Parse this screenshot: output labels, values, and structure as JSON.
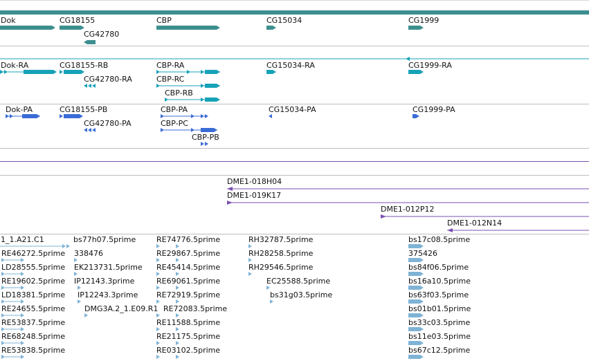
{
  "colors": {
    "gene": "#3d8f8f",
    "transcript": "#17a2b8",
    "protein": "#3b6bd6",
    "clone": "#7a4fb0",
    "est": "#7fb3d6",
    "divider": "#bdbdbd",
    "scale_bar": "#3d8f8f"
  },
  "tracks": {
    "genes": [
      {
        "name": "Dok"
      },
      {
        "name": "CG18155"
      },
      {
        "name": "CG42780"
      },
      {
        "name": "CBP"
      },
      {
        "name": "CG15034"
      },
      {
        "name": "CG1999"
      }
    ],
    "transcripts": [
      {
        "name": "Dok-RA"
      },
      {
        "name": "CG18155-RB"
      },
      {
        "name": "CG42780-RA"
      },
      {
        "name": "CBP-RA"
      },
      {
        "name": "CBP-RC"
      },
      {
        "name": "CBP-RB"
      },
      {
        "name": "CG15034-RA"
      },
      {
        "name": "CG1999-RA"
      }
    ],
    "proteins": [
      {
        "name": "Dok-PA"
      },
      {
        "name": "CG18155-PB"
      },
      {
        "name": "CG42780-PA"
      },
      {
        "name": "CBP-PA"
      },
      {
        "name": "CBP-PC"
      },
      {
        "name": "CBP-PB"
      },
      {
        "name": "CG15034-PA"
      },
      {
        "name": "CG1999-PA"
      }
    ],
    "clones": [
      {
        "name": "DME1-018H04"
      },
      {
        "name": "DME1-019K17"
      },
      {
        "name": "DME1-012P12"
      },
      {
        "name": "DME1-012N14"
      }
    ],
    "ests": [
      {
        "name": "1_1.A21.C1"
      },
      {
        "name": "RE46272.5prime"
      },
      {
        "name": "LD28555.5prime"
      },
      {
        "name": "RE19602.5prime"
      },
      {
        "name": "LD18381.5prime"
      },
      {
        "name": "RE24655.5prime"
      },
      {
        "name": "RE53837.5prime"
      },
      {
        "name": "RE68248.5prime"
      },
      {
        "name": "RE53838.5prime"
      },
      {
        "name": "bs77h07.5prime"
      },
      {
        "name": "338476"
      },
      {
        "name": "EK213731.5prime"
      },
      {
        "name": "IP12143.3prime"
      },
      {
        "name": "IP12243.3prime"
      },
      {
        "name": "DMG3A.2_1.E09.R1"
      },
      {
        "name": "RE74776.5prime"
      },
      {
        "name": "RE29867.5prime"
      },
      {
        "name": "RE45414.5prime"
      },
      {
        "name": "RE69061.5prime"
      },
      {
        "name": "RE72919.5prime"
      },
      {
        "name": "RE72083.5prime"
      },
      {
        "name": "RE11588.5prime"
      },
      {
        "name": "RE21175.5prime"
      },
      {
        "name": "RE03102.5prime"
      },
      {
        "name": "RH32787.5prime"
      },
      {
        "name": "RH28258.5prime"
      },
      {
        "name": "RH29546.5prime"
      },
      {
        "name": "EC25588.5prime"
      },
      {
        "name": "bs31g03.5prime"
      },
      {
        "name": "bs17c08.5prime"
      },
      {
        "name": "375426"
      },
      {
        "name": "bs84f06.5prime"
      },
      {
        "name": "bs16a10.5prime"
      },
      {
        "name": "bs63f03.5prime"
      },
      {
        "name": "bs01b01.5prime"
      },
      {
        "name": "bs33c03.5prime"
      },
      {
        "name": "bs11e03.5prime"
      },
      {
        "name": "bs67c12.5prime"
      }
    ]
  }
}
